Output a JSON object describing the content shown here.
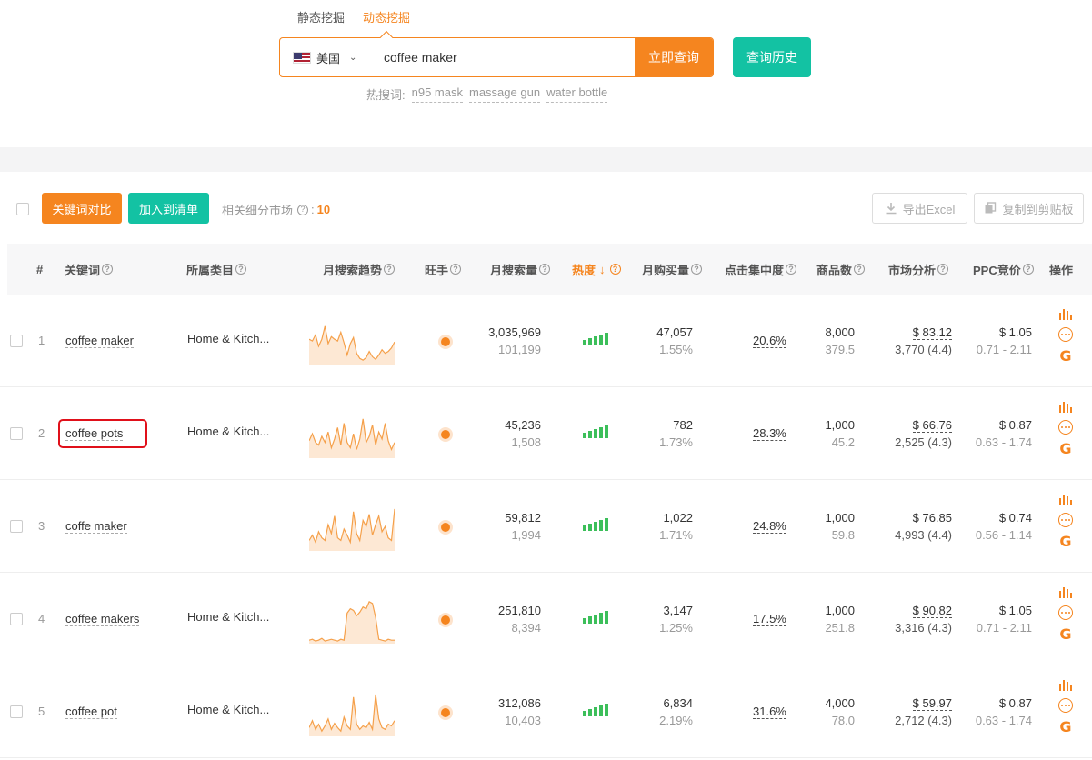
{
  "mode_tabs": {
    "static": "静态挖掘",
    "dynamic": "动态挖掘"
  },
  "search": {
    "country": "美国",
    "query": "coffee maker",
    "submit_label": "立即查询",
    "history_label": "查询历史"
  },
  "hot": {
    "label": "热搜词:",
    "words": [
      "n95 mask",
      "massage gun",
      "water bottle"
    ]
  },
  "toolbar": {
    "compare_label": "关键词对比",
    "add_label": "加入到清单",
    "related_label": "相关细分市场",
    "related_count": "10",
    "export_label": "导出Excel",
    "copy_label": "复制到剪贴板"
  },
  "columns": {
    "num": "#",
    "keyword": "关键词",
    "category": "所属类目",
    "trend": "月搜索趋势",
    "competitor": "旺手",
    "monthly_search": "月搜索量",
    "heat": "热度",
    "monthly_purchase": "月购买量",
    "click_concentration": "点击集中度",
    "products": "商品数",
    "market": "市场分析",
    "ppc": "PPC竞价",
    "actions": "操作"
  },
  "colors": {
    "accent_orange": "#f5851f",
    "accent_teal": "#13c2a3",
    "bar_green": "#3cbf5a",
    "highlight_red": "#e0101a"
  },
  "rows": [
    {
      "num": "1",
      "keyword": "coffee maker",
      "category": "Home & Kitch...",
      "search": "3,035,969",
      "search_sub": "101,199",
      "heat_level": 5,
      "purchase": "47,057",
      "purchase_sub": "1.55%",
      "click": "20.6%",
      "products": "8,000",
      "products_sub": "379.5",
      "price": "$ 83.12",
      "reviews": "3,770 (4.4)",
      "ppc": "$ 1.05",
      "ppc_range": "0.71 - 2.11",
      "trend": [
        30,
        28,
        35,
        22,
        30,
        45,
        25,
        33,
        30,
        28,
        38,
        26,
        12,
        25,
        32,
        14,
        8,
        6,
        9,
        16,
        10,
        7,
        12,
        18,
        14,
        16,
        20,
        27
      ]
    },
    {
      "num": "2",
      "keyword": "coffee pots",
      "category": "Home & Kitch...",
      "search": "45,236",
      "search_sub": "1,508",
      "heat_level": 5,
      "purchase": "782",
      "purchase_sub": "1.73%",
      "click": "28.3%",
      "products": "1,000",
      "products_sub": "45.2",
      "price": "$ 66.76",
      "reviews": "2,525 (4.3)",
      "ppc": "$ 0.87",
      "ppc_range": "0.63 - 1.74",
      "trend": [
        20,
        28,
        18,
        15,
        25,
        18,
        30,
        12,
        22,
        35,
        15,
        40,
        18,
        12,
        28,
        10,
        22,
        45,
        18,
        25,
        38,
        15,
        30,
        22,
        40,
        20,
        10,
        18
      ]
    },
    {
      "num": "3",
      "keyword": "coffe maker",
      "category": "",
      "search": "59,812",
      "search_sub": "1,994",
      "heat_level": 5,
      "purchase": "1,022",
      "purchase_sub": "1.71%",
      "click": "24.8%",
      "products": "1,000",
      "products_sub": "59.8",
      "price": "$ 76.85",
      "reviews": "4,993 (4.4)",
      "ppc": "$ 0.74",
      "ppc_range": "0.56 - 1.14",
      "trend": [
        12,
        18,
        10,
        22,
        15,
        12,
        30,
        20,
        40,
        15,
        12,
        25,
        18,
        10,
        45,
        20,
        12,
        35,
        28,
        42,
        18,
        30,
        40,
        22,
        28,
        15,
        12,
        48
      ]
    },
    {
      "num": "4",
      "keyword": "coffee makers",
      "category": "Home & Kitch...",
      "search": "251,810",
      "search_sub": "8,394",
      "heat_level": 5,
      "purchase": "3,147",
      "purchase_sub": "1.25%",
      "click": "17.5%",
      "products": "1,000",
      "products_sub": "251.8",
      "price": "$ 90.82",
      "reviews": "3,316 (4.3)",
      "ppc": "$ 1.05",
      "ppc_range": "0.71 - 2.11",
      "trend": [
        4,
        5,
        3,
        4,
        6,
        3,
        4,
        5,
        4,
        3,
        5,
        4,
        35,
        40,
        38,
        32,
        36,
        42,
        40,
        48,
        46,
        30,
        5,
        4,
        3,
        5,
        4,
        4
      ]
    },
    {
      "num": "5",
      "keyword": "coffee pot",
      "category": "Home & Kitch...",
      "search": "312,086",
      "search_sub": "10,403",
      "heat_level": 5,
      "purchase": "6,834",
      "purchase_sub": "2.19%",
      "click": "31.6%",
      "products": "4,000",
      "products_sub": "78.0",
      "price": "$ 59.97",
      "reviews": "2,712 (4.3)",
      "ppc": "$ 0.87",
      "ppc_range": "0.63 - 1.74",
      "trend": [
        10,
        18,
        8,
        14,
        6,
        12,
        20,
        8,
        15,
        10,
        6,
        22,
        12,
        8,
        45,
        14,
        8,
        12,
        10,
        16,
        8,
        48,
        20,
        10,
        8,
        14,
        12,
        18
      ]
    }
  ]
}
